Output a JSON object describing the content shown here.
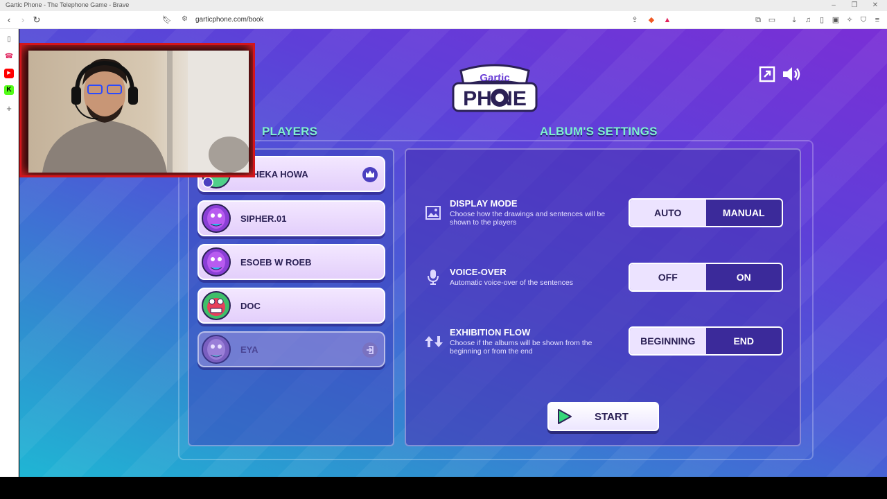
{
  "browser": {
    "window_title": "Gartic Phone - The Telephone Game - Brave",
    "url": "garticphone.com/book"
  },
  "game": {
    "logo_top": "Gartic",
    "logo_bottom": "PHONE",
    "players_title": "PLAYERS",
    "settings_title": "ALBUM'S SETTINGS",
    "players": [
      {
        "name": "ALHEKA HOWA",
        "host": true
      },
      {
        "name": "SIPHER.01"
      },
      {
        "name": "ESOEB W ROEB"
      },
      {
        "name": "DOC"
      },
      {
        "name": "EYA",
        "disconnected": true
      }
    ],
    "settings": [
      {
        "title": "DISPLAY MODE",
        "description": "Choose how the drawings and sentences will be shown to the players",
        "left": "AUTO",
        "right": "MANUAL",
        "selected": "left"
      },
      {
        "title": "VOICE-OVER",
        "description": "Automatic voice-over of the sentences",
        "left": "OFF",
        "right": "ON",
        "selected": "left"
      },
      {
        "title": "EXHIBITION FLOW",
        "description": "Choose if the albums will be shown from the beginning or from the end",
        "left": "BEGINNING",
        "right": "END",
        "selected": "left"
      }
    ],
    "start_label": "START"
  },
  "colors": {
    "accent_title": "#7ff0d0",
    "panel_border": "#ffffff",
    "webcam_border": "#d4151c"
  }
}
